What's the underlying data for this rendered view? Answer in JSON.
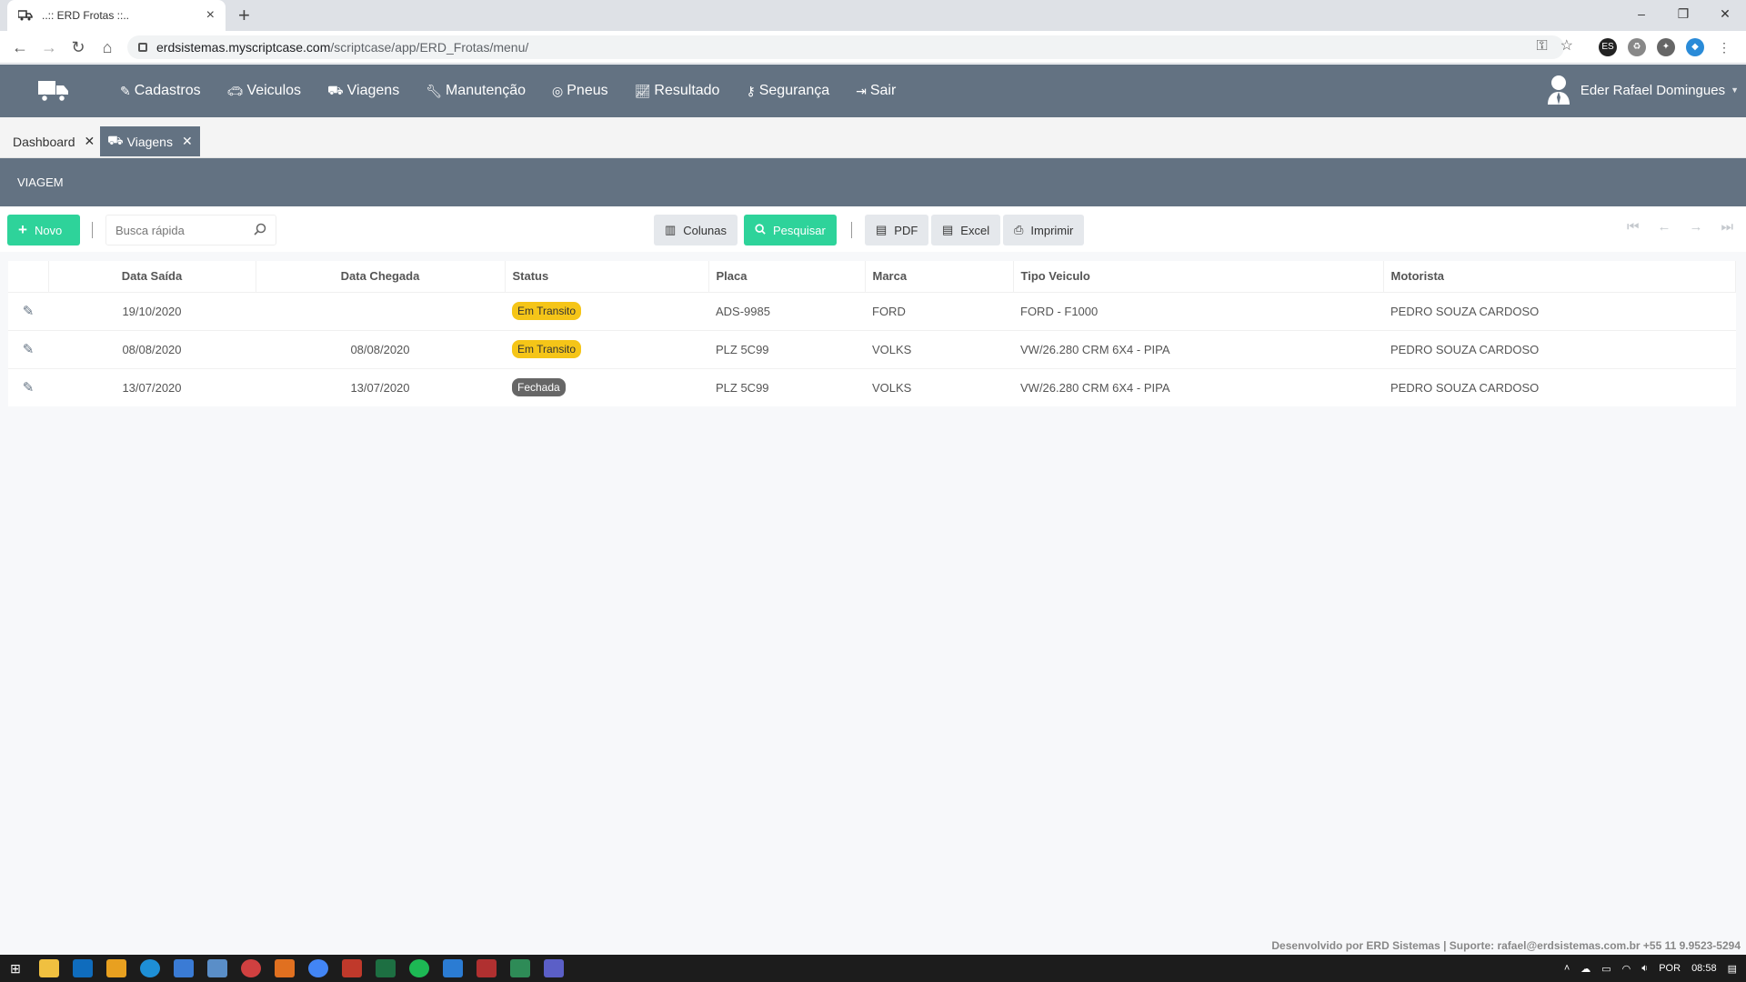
{
  "browser": {
    "tab_title": "..:: ERD Frotas ::..",
    "url_host": "erdsistemas.myscriptcase.com",
    "url_path": "/scriptcase/app/ERD_Frotas/menu/"
  },
  "app": {
    "menu": [
      {
        "label": "Cadastros",
        "icon": "edit-icon"
      },
      {
        "label": "Veiculos",
        "icon": "car-icon"
      },
      {
        "label": "Viagens",
        "icon": "truck-icon"
      },
      {
        "label": "Manutenção",
        "icon": "wrench-icon"
      },
      {
        "label": "Pneus",
        "icon": "tire-icon"
      },
      {
        "label": "Resultado",
        "icon": "chart-icon"
      },
      {
        "label": "Segurança",
        "icon": "key-icon"
      },
      {
        "label": "Sair",
        "icon": "sign-out-icon"
      }
    ],
    "user_name": "Eder Rafael Domingues"
  },
  "tabs": [
    {
      "label": "Dashboard"
    },
    {
      "label": "Viagens"
    }
  ],
  "section_title": "VIAGEM",
  "toolbar": {
    "new_label": "Novo",
    "search_placeholder": "Busca rápida",
    "columns_label": "Colunas",
    "search_label": "Pesquisar",
    "pdf_label": "PDF",
    "excel_label": "Excel",
    "print_label": "Imprimir"
  },
  "table": {
    "headers": [
      "Data Saída",
      "Data Chegada",
      "Status",
      "Placa",
      "Marca",
      "Tipo Veiculo",
      "Motorista"
    ],
    "rows": [
      {
        "saida": "19/10/2020",
        "chegada": "",
        "status": "Em Transito",
        "placa": "ADS-9985",
        "marca": "FORD",
        "tipo": "FORD - F1000",
        "motorista": "PEDRO SOUZA CARDOSO"
      },
      {
        "saida": "08/08/2020",
        "chegada": "08/08/2020",
        "status": "Em Transito",
        "placa": "PLZ 5C99",
        "marca": "VOLKS",
        "tipo": "VW/26.280 CRM 6X4 - PIPA",
        "motorista": "PEDRO SOUZA CARDOSO"
      },
      {
        "saida": "13/07/2020",
        "chegada": "13/07/2020",
        "status": "Fechada",
        "placa": "PLZ 5C99",
        "marca": "VOLKS",
        "tipo": "VW/26.280 CRM 6X4 - PIPA",
        "motorista": "PEDRO SOUZA CARDOSO"
      }
    ]
  },
  "footer": "Desenvolvido por ERD Sistemas | Suporte: rafael@erdsistemas.com.br +55 11 9.9523-5294",
  "taskbar": {
    "language": "POR",
    "time": "08:58"
  },
  "colors": {
    "header": "#637282",
    "accent_green": "#2ed39a",
    "badge_transit": "#f5c518",
    "badge_closed": "#666666"
  }
}
